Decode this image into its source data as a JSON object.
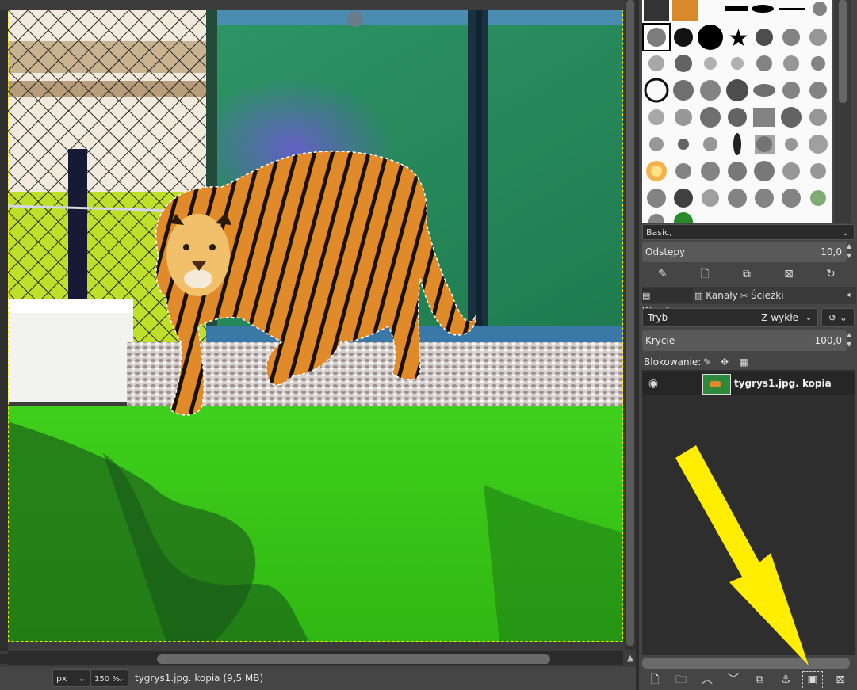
{
  "canvas": {
    "image_alt": "tiger walking in zoo enclosure with green fence and grass",
    "selection": "marching ants around tiger outline"
  },
  "statusbar": {
    "unit": "px",
    "zoom": "150 %",
    "image_info": "tygrys1.jpg. kopia (9,5 MB)"
  },
  "brushes": {
    "preset": "Basic,",
    "spacing_label": "Odstępy",
    "spacing_value": "10,0"
  },
  "layers_dock": {
    "tabs": [
      {
        "label": "Warstwy",
        "icon": "layers-icon"
      },
      {
        "label": "Kanały",
        "icon": "channels-icon"
      },
      {
        "label": "Ścieżki",
        "icon": "paths-icon"
      }
    ],
    "mode_label": "Tryb",
    "mode_value": "Z wykłe",
    "opacity_label": "Krycie",
    "opacity_value": "100,0",
    "lock_label": "Blokowanie:",
    "layers": [
      {
        "name": "tygrys1.jpg. kopia",
        "visible": true
      }
    ]
  },
  "colors": {
    "annotation_arrow": "#ffee00",
    "panel_bg": "#454545",
    "list_bg": "#2e2e2e"
  }
}
